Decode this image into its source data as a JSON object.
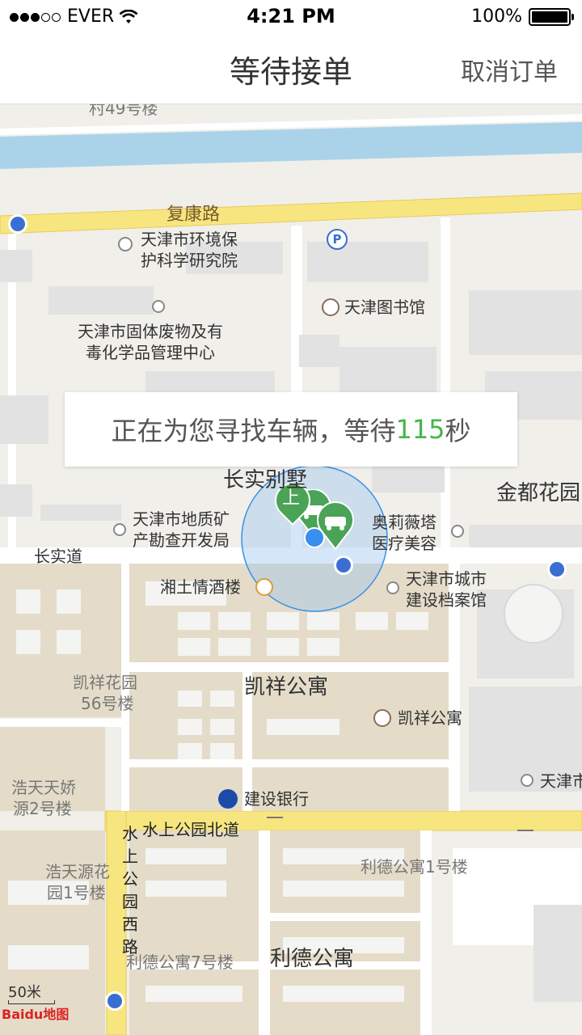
{
  "status_bar": {
    "carrier": "EVER",
    "time": "4:21 PM",
    "battery": "100%"
  },
  "nav": {
    "title": "等待接单",
    "cancel_label": "取消订单"
  },
  "toast": {
    "prefix": "正在为您寻找车辆，等待",
    "seconds": "115",
    "suffix": "秒"
  },
  "map": {
    "labels": {
      "top_building": "村49号楼",
      "fukang_road": "复康路",
      "env_institute_1": "天津市环境保",
      "env_institute_2": "护科学研究院",
      "library": "天津图书馆",
      "waste_center_1": "天津市固体废物及有",
      "waste_center_2": "毒化学品管理中心",
      "changshi_villa": "长实别墅",
      "jindu_garden": "金都花园",
      "geology_1": "天津市地质矿",
      "geology_2": "产勘查开发局",
      "olivia_1": "奥莉薇塔",
      "olivia_2": "医疗美容",
      "changshi_road": "长实道",
      "xiangtu_restaurant": "湘土情酒楼",
      "archives_1": "天津市城市",
      "archives_2": "建设档案馆",
      "kaixiang_garden_1": "凯祥花园",
      "kaixiang_garden_2": "56号楼",
      "kaixiang_apartment": "凯祥公寓",
      "kaixiang_apartment_poi": "凯祥公寓",
      "tianjin_city": "天津市",
      "haotian_1": "浩天天娇",
      "haotian_2": "源2号楼",
      "ccb": "建设银行",
      "shuishang_north": "水上公园北道",
      "shuishang_west": "水上公园西路",
      "haotianyuan_1": "浩天源花",
      "haotianyuan_2": "园1号楼",
      "lide_1": "利德公寓1号楼",
      "lide_7": "利德公寓7号楼",
      "lide_apartment": "利德公寓",
      "pickup_marker": "上",
      "scale": "50米",
      "logo_text": "Baidu地图"
    },
    "colors": {
      "road_major": "#f7e680",
      "river": "#aad3e9",
      "accent_green": "#44b649",
      "location_blue": "#3a8eef"
    }
  }
}
